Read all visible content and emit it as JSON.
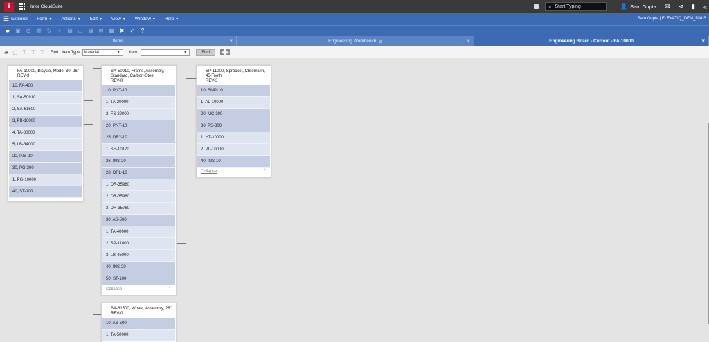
{
  "app": {
    "logo_letter": "i",
    "title": "Infor CloudSuite"
  },
  "topbar": {
    "search_placeholder": "Start Typing",
    "user_name": "Sam Gupta"
  },
  "menubar": {
    "explorer_label": "Explorer",
    "items": [
      "Form",
      "Actions",
      "Edit",
      "View",
      "Window",
      "Help"
    ],
    "context": "Sam Gupta | ELEVATIQ_DEM_DALS"
  },
  "tabs": [
    {
      "label": "Items"
    },
    {
      "label": "Engineering Workbench"
    },
    {
      "label": "Engineering Board - Current - FA-10000"
    }
  ],
  "findbar": {
    "find_label": "Find",
    "item_type_label": "Item Type",
    "item_type_value": "Material",
    "item_label": "Item",
    "item_value": "",
    "find_button": "Find"
  },
  "cards": [
    {
      "title": "FA-10000, Bicycle, Model-30, 26\"",
      "rev": "REV-3",
      "rows": [
        "10, FA-400",
        "1, SA-50910",
        "2, SA-61500",
        "3, PB-10000",
        "4, TA-30000",
        "5, LB-34000",
        "20, INS-20",
        "30, PG-300",
        "1, PG-10000",
        "40, ST-100"
      ],
      "footer": ""
    },
    {
      "title": "SA-50910, Frame, Assembly, Standard, Carbon-Steel",
      "rev": "REV-0",
      "rows": [
        "10, PNT-10",
        "1, TA-20000",
        "2, FS-22000",
        "20, PNT-10",
        "25, DRY-10",
        "1, SH-10120",
        "26, INS-20",
        "28, DRL-10",
        "1, DR-35960",
        "2, DR-35960",
        "3, DR-35760",
        "30, AS-500",
        "1, TA-40000",
        "2, SP-11000",
        "3, LB-45000",
        "40, INS-20",
        "50, ST-100"
      ],
      "footer": "Collapse"
    },
    {
      "title": "SP-11000, Sprocket, Chromium, 45-Tooth",
      "rev": "REV-3",
      "rows": [
        "10, SMP-10",
        "1, AL-10000",
        "20, MC-300",
        "30, PS-300",
        "1, HT-10000",
        "2, PL-10000",
        "40, INS-10"
      ],
      "footer": "Collapse"
    },
    {
      "title": "SA-61500, Wheel, Assembly, 26\"",
      "rev": "REV-0",
      "rows": [
        "10, AS-500",
        "1, TA-50000"
      ],
      "footer": ""
    }
  ]
}
